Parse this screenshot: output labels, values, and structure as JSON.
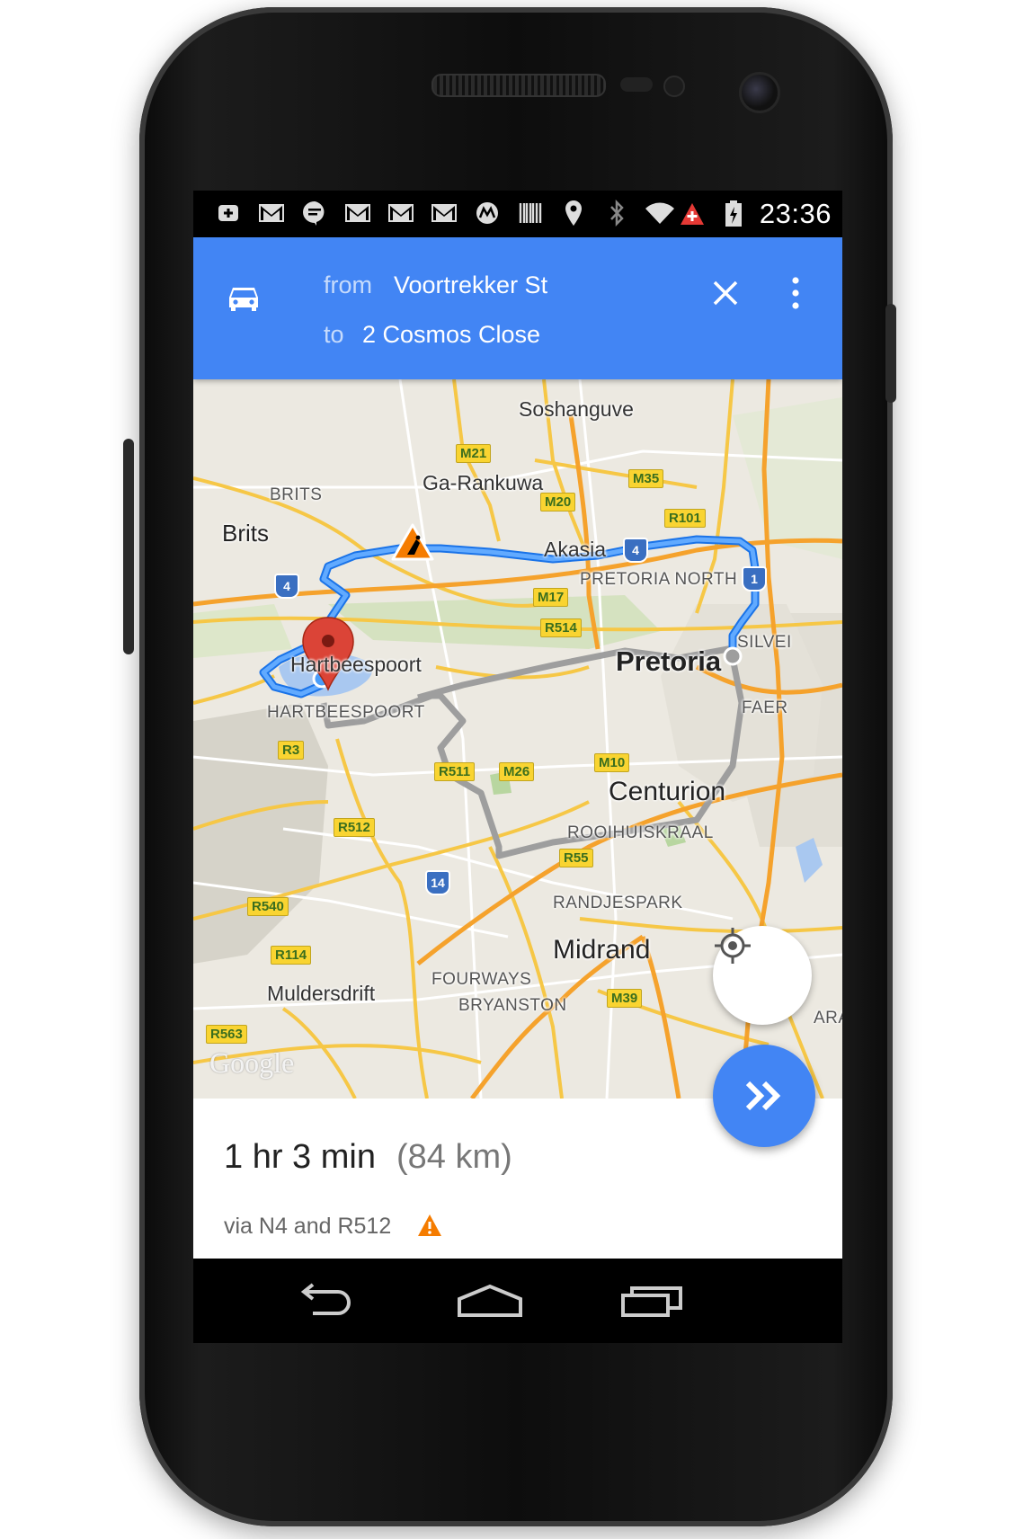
{
  "status_bar": {
    "icons": [
      "plus-box-icon",
      "gmail-icon",
      "hangouts-icon",
      "gmail-icon",
      "gmail-icon",
      "gmail-icon",
      "motorola-icon",
      "barcode-icon",
      "location-icon",
      "bluetooth-icon",
      "wifi-icon",
      "no-signal-icon",
      "battery-charging-icon"
    ],
    "time": "23:36"
  },
  "directions": {
    "mode_icon": "car-icon",
    "from_label": "from",
    "from_value": "Voortrekker St",
    "to_label": "to",
    "to_value": "2 Cosmos Close"
  },
  "map": {
    "places": {
      "soshanguve": "Soshanguve",
      "ga_rankuwa": "Ga-Rankuwa",
      "brits_caps": "BRITS",
      "brits": "Brits",
      "akasia": "Akasia",
      "pretoria_north": "PRETORIA NORTH",
      "hartbeespoort": "Hartbeespoort",
      "hartbeespoort_caps": "HARTBEESPOORT",
      "pretoria": "Pretoria",
      "silver": "SILVEI",
      "faer": "FAER",
      "centurion": "Centurion",
      "rooihuiskraal": "ROOIHUISKRAAL",
      "randjespark": "RANDJESPARK",
      "midrand": "Midrand",
      "muldersdrift": "Muldersdrift",
      "fourways": "FOURWAYS",
      "bryanston": "BRYANSTON",
      "ara": "ARA"
    },
    "road_shields": [
      "M21",
      "M35",
      "M20",
      "R101",
      "M17",
      "R514",
      "R3",
      "R511",
      "M26",
      "M10",
      "R512",
      "R55",
      "R540",
      "R114",
      "M39",
      "R563"
    ],
    "national_routes": [
      "4",
      "4",
      "1",
      "14"
    ],
    "watermark": "Google"
  },
  "route": {
    "duration": "1 hr 3 min",
    "distance": "(84 km)",
    "via": "via N4 and R512",
    "warning_icon": "warning-icon"
  },
  "colors": {
    "appbar": "#4285f4",
    "route_primary": "#4a9df8",
    "route_alt": "#9e9e9e",
    "marker": "#db4437"
  },
  "nav_bar": {
    "buttons": [
      "back-icon",
      "home-icon",
      "recents-icon"
    ]
  }
}
